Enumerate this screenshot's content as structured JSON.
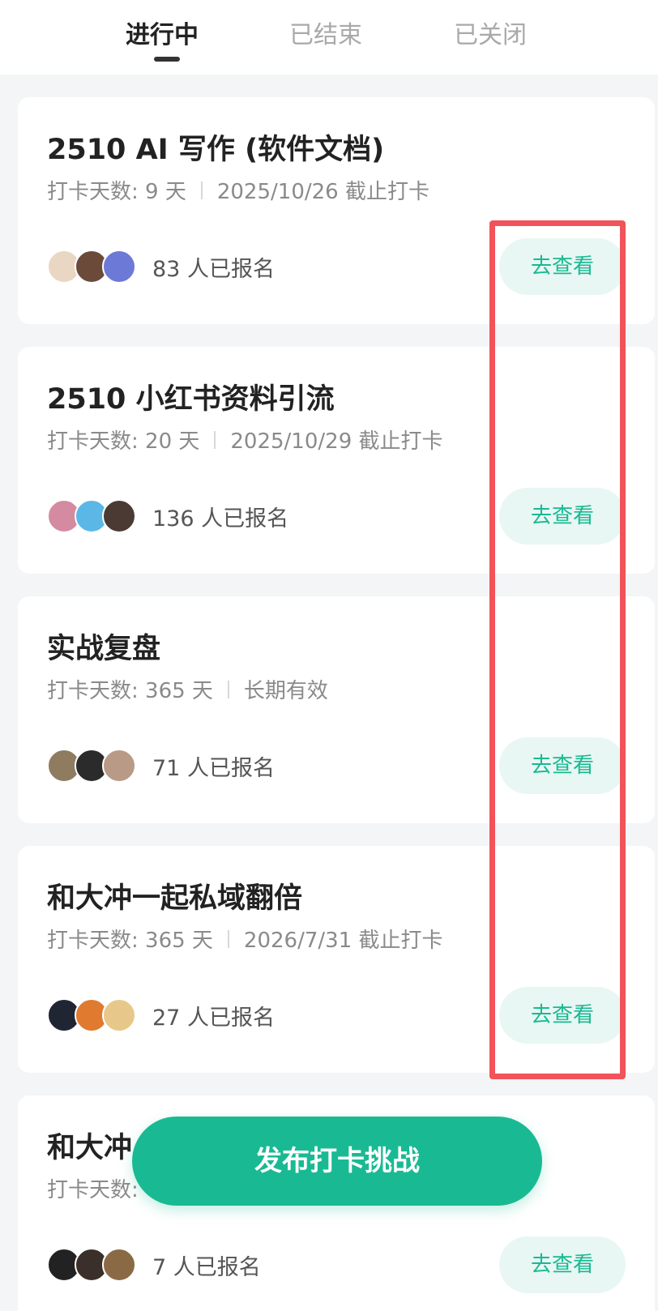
{
  "tabs": [
    {
      "label": "进行中",
      "active": true
    },
    {
      "label": "已结束",
      "active": false
    },
    {
      "label": "已关闭",
      "active": false
    }
  ],
  "cards": [
    {
      "title": "2510 AI 写作 (软件文档)",
      "days": "打卡天数: 9 天",
      "deadline": "2025/10/26 截止打卡",
      "signup": "83 人已报名",
      "button": "去查看",
      "avatar_colors": [
        "#e9d7c3",
        "#6b4a3a",
        "#6c79d6"
      ]
    },
    {
      "title": "2510 小红书资料引流",
      "days": "打卡天数: 20 天",
      "deadline": "2025/10/29 截止打卡",
      "signup": "136 人已报名",
      "button": "去查看",
      "avatar_colors": [
        "#d48aa0",
        "#5bb7e6",
        "#4a3a33"
      ]
    },
    {
      "title": "实战复盘",
      "days": "打卡天数: 365 天",
      "deadline": "长期有效",
      "signup": "71 人已报名",
      "button": "去查看",
      "avatar_colors": [
        "#8f7b5f",
        "#2b2b2b",
        "#b99a86"
      ]
    },
    {
      "title": "和大冲一起私域翻倍",
      "days": "打卡天数: 365 天",
      "deadline": "2026/7/31 截止打卡",
      "signup": "27 人已报名",
      "button": "去查看",
      "avatar_colors": [
        "#1f2533",
        "#e07a2f",
        "#e8c88a"
      ]
    },
    {
      "title": "和大冲",
      "days": "打卡天数:",
      "deadline": "",
      "signup": "7 人已报名",
      "button": "去查看",
      "avatar_colors": [
        "#222222",
        "#3b3029",
        "#8a6a45"
      ]
    }
  ],
  "publish_button": "发布打卡挑战",
  "accent_color": "#19ba93",
  "highlight_color": "#f2525a"
}
